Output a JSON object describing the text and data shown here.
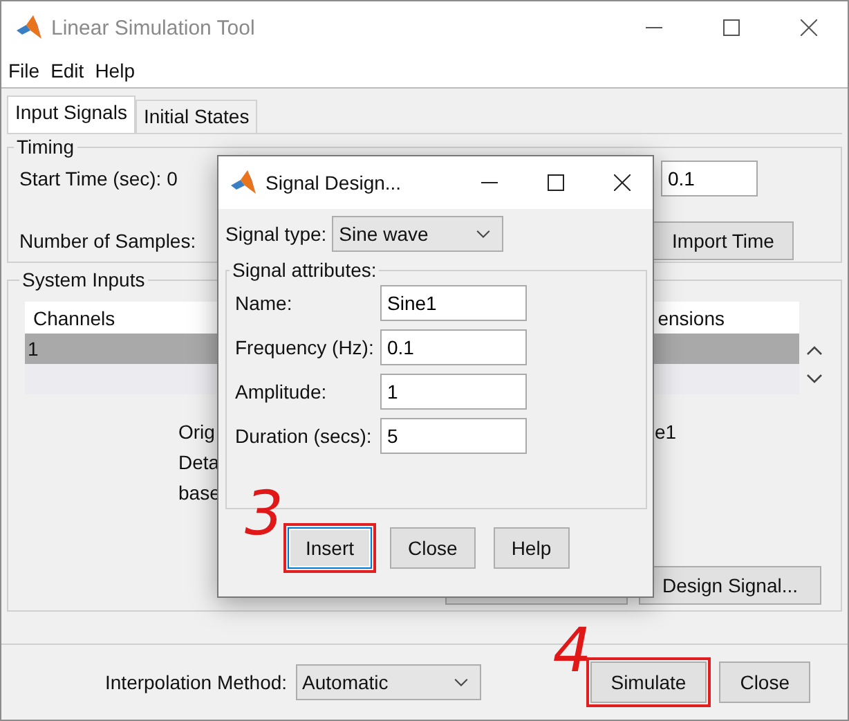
{
  "window": {
    "title": "Linear Simulation Tool"
  },
  "menu": [
    "File",
    "Edit",
    "Help"
  ],
  "tabs": [
    {
      "label": "Input Signals",
      "selected": true
    },
    {
      "label": "Initial States",
      "selected": false
    }
  ],
  "timing": {
    "title": "Timing",
    "start_time": "Start Time (sec): 0",
    "end_value": "0.1",
    "samples_label": "Number of Samples:",
    "import_button": "Import Time"
  },
  "system_inputs": {
    "title": "System Inputs",
    "columns": [
      "Channels",
      "ensions"
    ],
    "rows": [
      {
        "channel": "1",
        "selected": true
      },
      {
        "selected": false
      }
    ],
    "details": [
      "Orig",
      "Deta",
      "base"
    ],
    "detail_right": "e1",
    "design_button": "Design Signal..."
  },
  "interpolation": {
    "label": "Interpolation Method:",
    "value": "Automatic"
  },
  "actions": [
    {
      "label": "Simulate",
      "highlighted": true,
      "annotation": "4"
    },
    {
      "label": "Close",
      "highlighted": false
    }
  ],
  "dialog": {
    "title": "Signal Design...",
    "signal_type_label": "Signal type:",
    "signal_type": "Sine wave",
    "attributes_title": "Signal attributes:",
    "fields": [
      {
        "label": "Name:",
        "value": "Sine1"
      },
      {
        "label": "Frequency (Hz):",
        "value": "0.1"
      },
      {
        "label": "Amplitude:",
        "value": "1"
      },
      {
        "label": "Duration (secs):",
        "value": "5"
      }
    ],
    "buttons": [
      {
        "label": "Insert",
        "highlighted": true,
        "focused": true,
        "annotation": "3"
      },
      {
        "label": "Close",
        "highlighted": false,
        "focused": false
      },
      {
        "label": "Help",
        "highlighted": false,
        "focused": false
      }
    ]
  }
}
